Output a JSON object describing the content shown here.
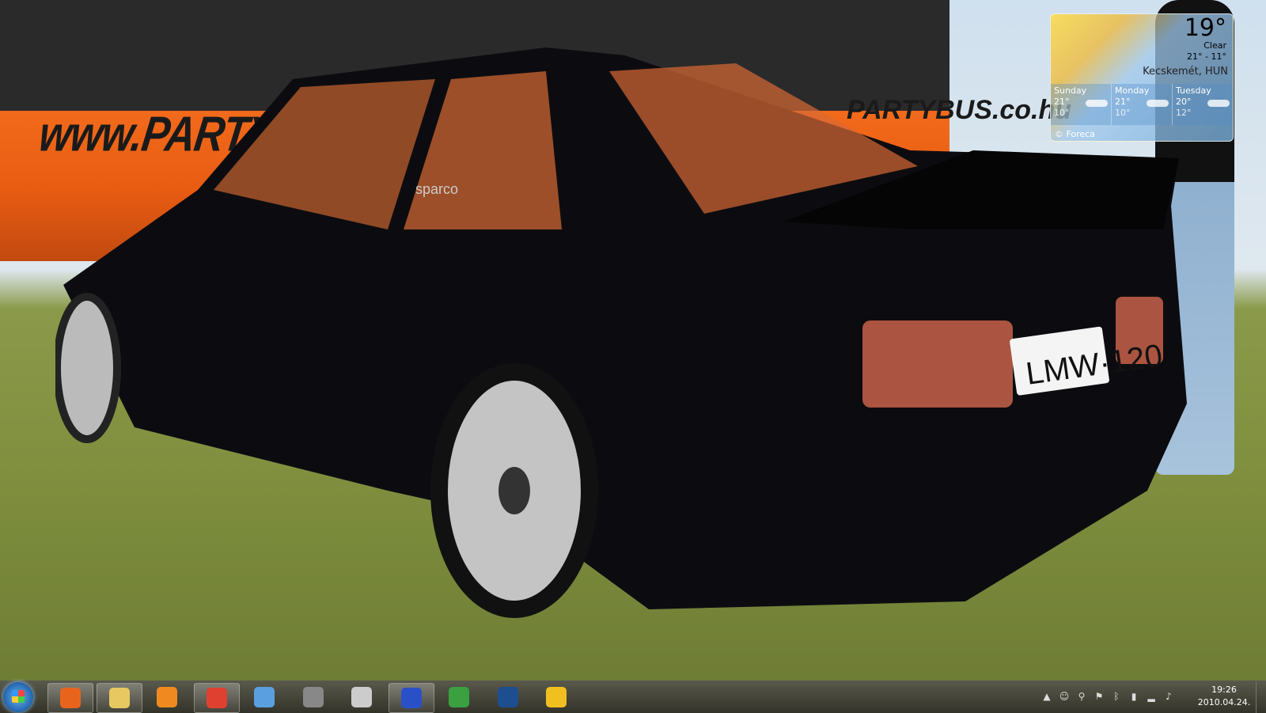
{
  "wallpaper": {
    "bus_text": "www.PARTYBUS.co.hu",
    "bus_text_rear": "PARTYBUS.co.hu",
    "plate": "LMW·120",
    "seat_brand": "sparco"
  },
  "weather": {
    "temp": "19°",
    "condition": "Clear",
    "range": "21° - 11°",
    "location": "Kecskemét, HUN",
    "days": [
      {
        "name": "Sunday",
        "high": "21°",
        "low": "10°"
      },
      {
        "name": "Monday",
        "high": "21°",
        "low": "10°"
      },
      {
        "name": "Tuesday",
        "high": "20°",
        "low": "12°"
      }
    ],
    "provider": "© Foreca"
  },
  "taskbar": {
    "apps": [
      {
        "name": "firefox",
        "color": "#e8641c",
        "pinned": true
      },
      {
        "name": "explorer",
        "color": "#e8c860",
        "pinned": true
      },
      {
        "name": "media-player",
        "color": "#f08a20",
        "pinned": false
      },
      {
        "name": "paint-app",
        "color": "#e04030",
        "pinned": true
      },
      {
        "name": "messenger",
        "color": "#5aa0e0",
        "pinned": false
      },
      {
        "name": "winamp",
        "color": "#888888",
        "pinned": false
      },
      {
        "name": "disc-app",
        "color": "#cccccc",
        "pinned": false
      },
      {
        "name": "save-app",
        "color": "#2a50c8",
        "pinned": true
      },
      {
        "name": "utorrent",
        "color": "#3aa040",
        "pinned": false
      },
      {
        "name": "photoshop",
        "color": "#1c4e90",
        "pinned": false
      },
      {
        "name": "lightning-app",
        "color": "#f0c020",
        "pinned": false
      }
    ],
    "tray_icons": [
      "show-hidden-icon",
      "network-user-icon",
      "usb-icon",
      "flag-icon",
      "bluetooth-icon",
      "battery-icon",
      "signal-icon",
      "volume-icon"
    ],
    "time": "19:26",
    "date": "2010.04.24."
  }
}
